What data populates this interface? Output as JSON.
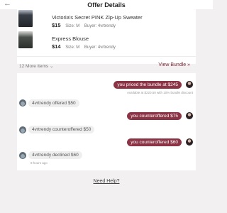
{
  "header": {
    "title": "Offer Details",
    "back_icon": "back-arrow-icon"
  },
  "bundle": {
    "items": [
      {
        "name": "Victoria's Secret PINK Zip-Up Sweater",
        "price": "$15",
        "size": "Size: M",
        "buyer": "Buyer: 4vrtrendy"
      },
      {
        "name": "Express Blouse",
        "price": "$14",
        "size": "Size: M",
        "buyer": "Buyer: 4vrtrendy"
      }
    ],
    "more_items": "12 More items",
    "more_icon": "chevron-down-icon",
    "view_bundle": "View Bundle »"
  },
  "chat": {
    "msg1": "you priced the bundle at $245",
    "msg1_note": "Available at $220.50 with 10% bundle discount",
    "msg2": "4vrtrendy offered $50",
    "msg3": "you counteroffered $75",
    "msg4": "4vrtrendy counteroffered $50",
    "msg5": "you counteroffered $60",
    "msg6": "4vrtrendy declined $60",
    "msg6_time": "8 hours ago"
  },
  "footer": {
    "need_help": "Need Help?"
  },
  "colors": {
    "accent": "#8b3445",
    "link": "#7d2638",
    "background": "#f2f0f0"
  }
}
